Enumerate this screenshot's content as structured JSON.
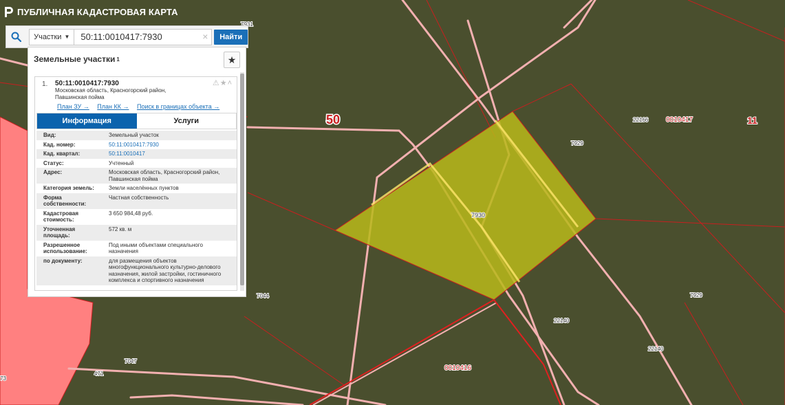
{
  "header": {
    "title": "ПУБЛИЧНАЯ КАДАСТРОВАЯ КАРТА"
  },
  "search": {
    "type_label": "Участки",
    "query": "50:11:0010417:7930",
    "clear_icon": "close-icon",
    "button_label": "Найти"
  },
  "panel": {
    "title": "Земельные участки",
    "count": "1",
    "result": {
      "index": "1.",
      "cad_number": "50:11:0010417:7930",
      "address_short": "Московская область, Красногорский район, Павшинская пойма",
      "links": [
        "План ЗУ →",
        "План КК →",
        "Поиск в границах объекта →"
      ]
    },
    "tabs": [
      "Информация",
      "Услуги"
    ],
    "info": [
      {
        "key": "Вид:",
        "value": "Земельный участок",
        "link": false
      },
      {
        "key": "Кад. номер:",
        "value": "50:11:0010417:7930",
        "link": true
      },
      {
        "key": "Кад. квартал:",
        "value": "50:11:0010417",
        "link": true
      },
      {
        "key": "Статус:",
        "value": "Учтенный",
        "link": false
      },
      {
        "key": "Адрес:",
        "value": "Московская область, Красногорский район, Павшинская пойма",
        "link": false
      },
      {
        "key": "Категория земель:",
        "value": "Земли населённых пунктов",
        "link": false
      },
      {
        "key": "Форма собственности:",
        "value": "Частная собственность",
        "link": false
      },
      {
        "key": "Кадастровая стоимость:",
        "value": "3 650 984,48 руб.",
        "link": false
      },
      {
        "key": "Уточненная площадь:",
        "value": "572 кв. м",
        "link": false
      },
      {
        "key": "Разрешенное использование:",
        "value": "Под иными объектами специального назначения",
        "link": false
      },
      {
        "key": "по документу:",
        "value": "для размещения объектов многофункционального культурно-делового назначения, жилой застройки, гостиничного комплекса и спортивного назначения",
        "link": false
      }
    ]
  },
  "map": {
    "labels": {
      "district": "50",
      "region": "11",
      "quarter_top": "0010417",
      "quarter_bottom": "0010416",
      "p7930": "7930",
      "p7931": "7931",
      "p7929a": "7929",
      "p7929b": "7929",
      "p22166": "22166",
      "p22140a": "22140",
      "p22140b": "22140",
      "p7044": "7044",
      "p7047": "7047",
      "p471": "471",
      "p73": "73"
    },
    "colors": {
      "background": "#4a4f2e",
      "selected_fill": "#b9b81a",
      "road": "#f2b0b0",
      "boundary": "#c81f1f",
      "zone": "#ff7f7f"
    }
  }
}
